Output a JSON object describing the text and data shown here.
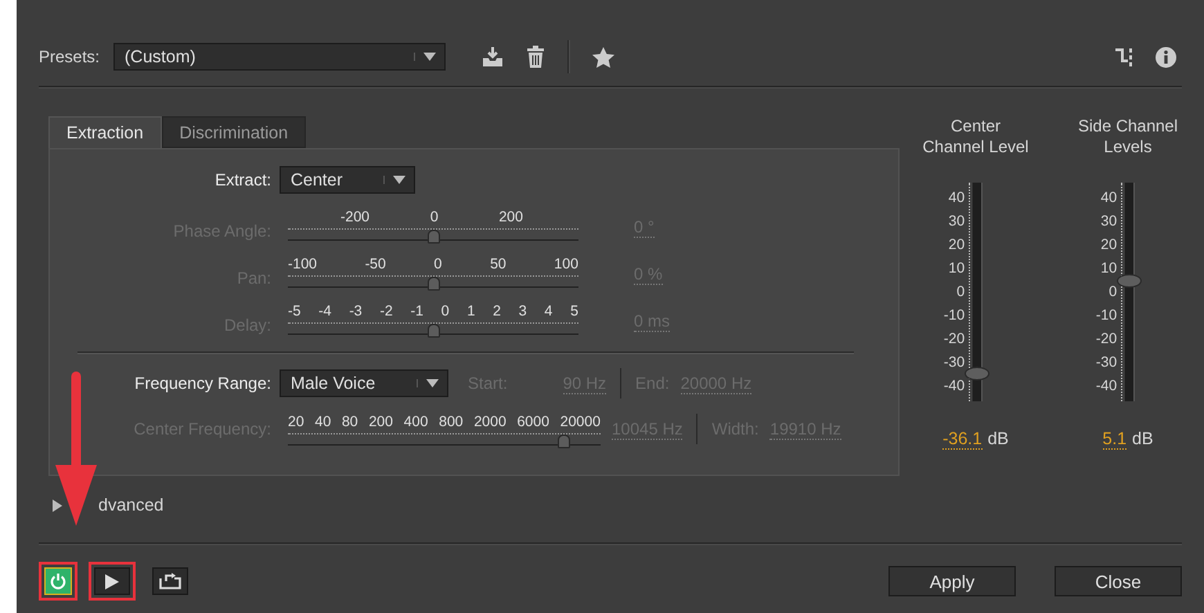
{
  "presets": {
    "label": "Presets:",
    "value": "(Custom)"
  },
  "tabs": [
    {
      "label": "Extraction",
      "selected": true
    },
    {
      "label": "Discrimination",
      "selected": false
    }
  ],
  "extract": {
    "label": "Extract:",
    "value": "Center"
  },
  "sliders": [
    {
      "label": "Phase Angle:",
      "scale": [
        "-200",
        "0",
        "200"
      ],
      "level": 0.5,
      "value": "0 °",
      "disabled": true
    },
    {
      "label": "Pan:",
      "scale": [
        "-100",
        "-50",
        "0",
        "50",
        "100"
      ],
      "level": 0.5,
      "value": "0 %",
      "disabled": true
    },
    {
      "label": "Delay:",
      "scale": [
        "-5",
        "-4",
        "-3",
        "-2",
        "-1",
        "0",
        "1",
        "2",
        "3",
        "4",
        "5"
      ],
      "level": 0.5,
      "value": "0 ms",
      "disabled": true
    }
  ],
  "frequency_range": {
    "label": "Frequency Range:",
    "value": "Male Voice",
    "start_label": "Start:",
    "start": "90 Hz",
    "end_label": "End:",
    "end": "20000 Hz",
    "disabled": true
  },
  "center_frequency": {
    "label": "Center Frequency:",
    "scale": [
      "20",
      "40",
      "80",
      "200",
      "400",
      "800",
      "2000",
      "6000",
      "20000"
    ],
    "level": 0.88,
    "value": "10045 Hz",
    "width_label": "Width:",
    "width": "19910 Hz",
    "disabled": true
  },
  "advanced": {
    "label": "dvanced",
    "expanded": false
  },
  "meters": [
    {
      "title": "Center Channel Level",
      "scale": [
        "40",
        "30",
        "20",
        "10",
        "0",
        "-10",
        "-20",
        "-30",
        "-40"
      ],
      "level": 0.124,
      "value": "-36.1",
      "unit": "dB"
    },
    {
      "title": "Side Channel Levels",
      "scale": [
        "40",
        "30",
        "20",
        "10",
        "0",
        "-10",
        "-20",
        "-30",
        "-40"
      ],
      "level": 0.553,
      "value": "5.1",
      "unit": "dB"
    }
  ],
  "transport": [
    {
      "kind": "power",
      "on": true,
      "highlighted": true
    },
    {
      "kind": "play",
      "on": false,
      "highlighted": true
    },
    {
      "kind": "loop",
      "on": false,
      "highlighted": false
    }
  ],
  "buttons": [
    "Apply",
    "Close"
  ],
  "annotations": [
    {
      "kind": "arrow"
    }
  ]
}
